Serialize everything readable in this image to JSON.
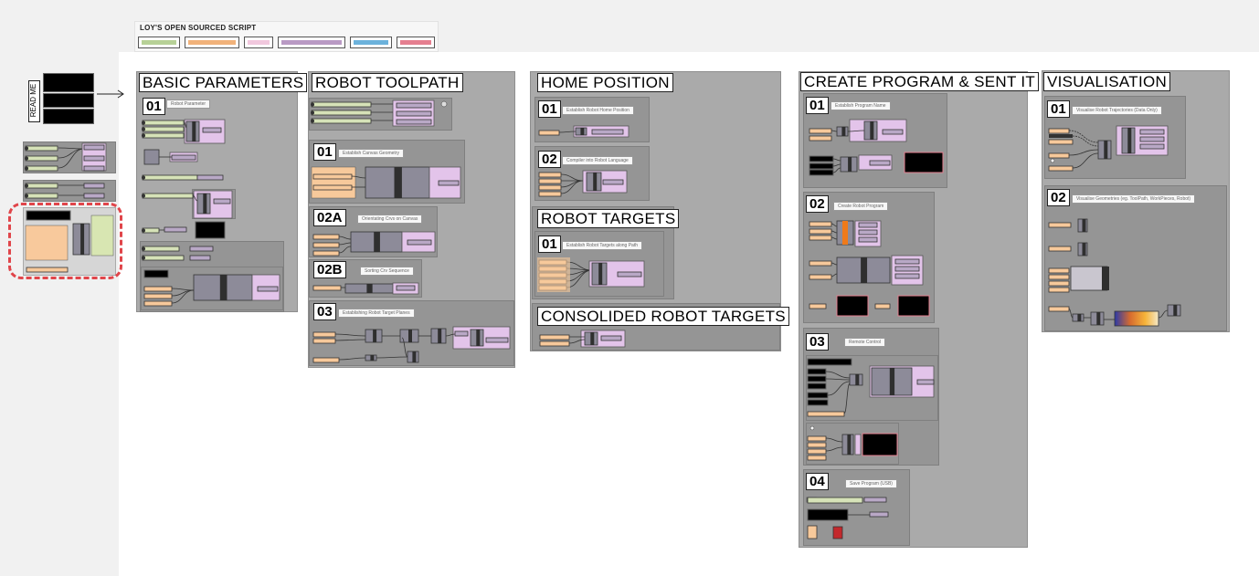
{
  "header": {
    "title": "LOY'S OPEN SOURCED SCRIPT"
  },
  "legend": {
    "swatches": [
      {
        "name": "legend-green",
        "fill": "#b7d197"
      },
      {
        "name": "legend-orange",
        "fill": "#f1b27a"
      },
      {
        "name": "legend-pink",
        "fill": "#f1c8de"
      },
      {
        "name": "legend-purple",
        "fill": "#b99ac4"
      },
      {
        "name": "legend-blue",
        "fill": "#6cb2dc"
      },
      {
        "name": "legend-red",
        "fill": "#e57f90"
      }
    ]
  },
  "readme": {
    "label": "READ ME"
  },
  "colors": {
    "panel": "#aaaaaa",
    "sub": "#959595",
    "component": "#8d8b99",
    "input": "#f7c99b",
    "output": "#e3c4ea",
    "wire": "#333333",
    "dashed": "#e0454a",
    "slider": "#d6e2b8"
  },
  "groups": {
    "basic": {
      "title": "BASIC PARAMETERS",
      "n01": "01",
      "note01": "Robot Parameter"
    },
    "toolpath": {
      "title": "ROBOT TOOLPATH",
      "n01": "01",
      "note01": "Establish Canvas Geometry",
      "n02a": "02A",
      "note02a": "Orientating Crvs on Canvas",
      "n02b": "02B",
      "note02b": "Sorting Crv Sequence",
      "n03": "03",
      "note03": "Establishing Robot Target Planes"
    },
    "home": {
      "title": "HOME POSITION",
      "n01": "01",
      "note01": "Establish Robot Home Position",
      "n02": "02",
      "note02": "Compiler into Robot Language"
    },
    "targets": {
      "title": "ROBOT TARGETS",
      "n01": "01",
      "note01": "Establish Robot Targets along Path"
    },
    "consolidated": {
      "title": "CONSOLIDED ROBOT TARGETS"
    },
    "program": {
      "title": "CREATE PROGRAM & SENT IT",
      "n01": "01",
      "note01": "Establish Program Name",
      "n02": "02",
      "note02": "Create Robot Program",
      "n03": "03",
      "note03": "Remote Control",
      "n04": "04",
      "note04": "Save Program (USB)"
    },
    "visual": {
      "title": "VISUALISATION",
      "n01": "01",
      "note01": "Visualise Robot Trajectories (Data Only)",
      "n02": "02",
      "note02": "Visualise Geometries (eg. ToolPath, WorkPieces, Robot)"
    }
  }
}
